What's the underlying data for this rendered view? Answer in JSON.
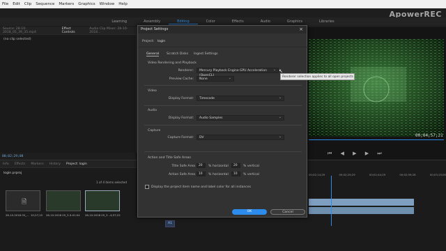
{
  "menu": [
    "File",
    "Edit",
    "Clip",
    "Sequence",
    "Markers",
    "Graphics",
    "Window",
    "Help"
  ],
  "watermark": "ApowerREC",
  "workspaces": [
    "Learning",
    "Assembly",
    "Editing",
    "Color",
    "Effects",
    "Audio",
    "Graphics",
    "Libraries"
  ],
  "workspace_active": "Editing",
  "source_panel": {
    "tabs": [
      "Source: 28-10-2018_05_39_35.mp4",
      "Effect Controls",
      "Audio Clip Mixer: 28-10-2018..."
    ],
    "active_tab": "Effect Controls",
    "no_clip": "(no clip selected)",
    "timecode": "00;02;29;08"
  },
  "program_panel": {
    "timecode": "00;04;57;21"
  },
  "project_panel": {
    "tabs": [
      "Info",
      "Effects",
      "Markers",
      "History",
      "Project: login"
    ],
    "active_tab": "Project: login",
    "project_file": "login.prproj",
    "item_count": "1 of 4 items selected",
    "items": [
      {
        "name": "28-10-2018 05_...",
        "duration": "10;27;15"
      },
      {
        "name": "28-10-2018 05_3...",
        "duration": "5:01:04"
      },
      {
        "name": "28-10-2018 05_3...",
        "duration": "4;57;22"
      }
    ]
  },
  "timeline": {
    "ruler": [
      "00;02;14;29",
      "00;02;29;29",
      "00;02;44;29",
      "00;02;59;28",
      "00;03;14;28",
      "00;03;29;28",
      "00;03;15;00"
    ]
  },
  "dialog": {
    "title": "Project Settings",
    "project_label": "Project:",
    "project_name": "login",
    "tabs": [
      "General",
      "Scratch Disks",
      "Ingest Settings"
    ],
    "active_tab": "General",
    "video_rendering": {
      "heading": "Video Rendering and Playback",
      "renderer_label": "Renderer:",
      "renderer_value": "Mercury Playback Engine GPU Acceleration (OpenCL)",
      "preview_cache_label": "Preview Cache:",
      "preview_cache_value": "None"
    },
    "video": {
      "heading": "Video",
      "display_format_label": "Display Format:",
      "display_format_value": "Timecode"
    },
    "audio": {
      "heading": "Audio",
      "display_format_label": "Display Format:",
      "display_format_value": "Audio Samples"
    },
    "capture": {
      "heading": "Capture",
      "capture_format_label": "Capture Format:",
      "capture_format_value": "DV"
    },
    "safe_areas": {
      "heading": "Action and Title Safe Areas",
      "title_label": "Title Safe Area",
      "title_h": "20",
      "title_v": "20",
      "action_label": "Action Safe Area",
      "action_h": "10",
      "action_v": "10",
      "pct_h": "% horizontal",
      "pct_v": "% vertical"
    },
    "checkbox_label": "Display the project item name and label color for all instances",
    "ok": "OK",
    "cancel": "Cancel"
  },
  "tooltip": "Renderer selection applies to all open projects"
}
